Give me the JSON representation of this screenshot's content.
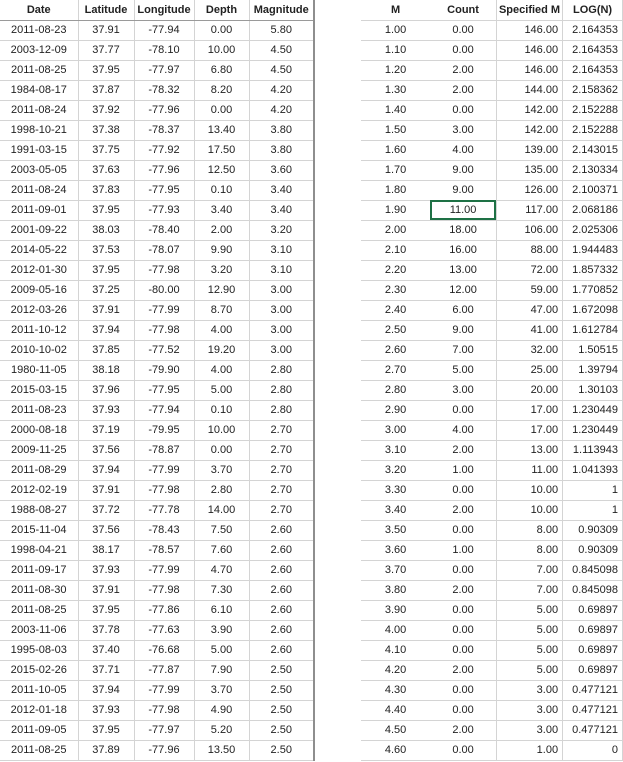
{
  "left_table": {
    "headers": [
      "Date",
      "Latitude",
      "Longitude",
      "Depth",
      "Magnitude"
    ],
    "rows": [
      [
        "2011-08-23",
        "37.91",
        "-77.94",
        "0.00",
        "5.80"
      ],
      [
        "2003-12-09",
        "37.77",
        "-78.10",
        "10.00",
        "4.50"
      ],
      [
        "2011-08-25",
        "37.95",
        "-77.97",
        "6.80",
        "4.50"
      ],
      [
        "1984-08-17",
        "37.87",
        "-78.32",
        "8.20",
        "4.20"
      ],
      [
        "2011-08-24",
        "37.92",
        "-77.96",
        "0.00",
        "4.20"
      ],
      [
        "1998-10-21",
        "37.38",
        "-78.37",
        "13.40",
        "3.80"
      ],
      [
        "1991-03-15",
        "37.75",
        "-77.92",
        "17.50",
        "3.80"
      ],
      [
        "2003-05-05",
        "37.63",
        "-77.96",
        "12.50",
        "3.60"
      ],
      [
        "2011-08-24",
        "37.83",
        "-77.95",
        "0.10",
        "3.40"
      ],
      [
        "2011-09-01",
        "37.95",
        "-77.93",
        "3.40",
        "3.40"
      ],
      [
        "2001-09-22",
        "38.03",
        "-78.40",
        "2.00",
        "3.20"
      ],
      [
        "2014-05-22",
        "37.53",
        "-78.07",
        "9.90",
        "3.10"
      ],
      [
        "2012-01-30",
        "37.95",
        "-77.98",
        "3.20",
        "3.10"
      ],
      [
        "2009-05-16",
        "37.25",
        "-80.00",
        "12.90",
        "3.00"
      ],
      [
        "2012-03-26",
        "37.91",
        "-77.99",
        "8.70",
        "3.00"
      ],
      [
        "2011-10-12",
        "37.94",
        "-77.98",
        "4.00",
        "3.00"
      ],
      [
        "2010-10-02",
        "37.85",
        "-77.52",
        "19.20",
        "3.00"
      ],
      [
        "1980-11-05",
        "38.18",
        "-79.90",
        "4.00",
        "2.80"
      ],
      [
        "2015-03-15",
        "37.96",
        "-77.95",
        "5.00",
        "2.80"
      ],
      [
        "2011-08-23",
        "37.93",
        "-77.94",
        "0.10",
        "2.80"
      ],
      [
        "2000-08-18",
        "37.19",
        "-79.95",
        "10.00",
        "2.70"
      ],
      [
        "2009-11-25",
        "37.56",
        "-78.87",
        "0.00",
        "2.70"
      ],
      [
        "2011-08-29",
        "37.94",
        "-77.99",
        "3.70",
        "2.70"
      ],
      [
        "2012-02-19",
        "37.91",
        "-77.98",
        "2.80",
        "2.70"
      ],
      [
        "1988-08-27",
        "37.72",
        "-77.78",
        "14.00",
        "2.70"
      ],
      [
        "2015-11-04",
        "37.56",
        "-78.43",
        "7.50",
        "2.60"
      ],
      [
        "1998-04-21",
        "38.17",
        "-78.57",
        "7.60",
        "2.60"
      ],
      [
        "2011-09-17",
        "37.93",
        "-77.99",
        "4.70",
        "2.60"
      ],
      [
        "2011-08-30",
        "37.91",
        "-77.98",
        "7.30",
        "2.60"
      ],
      [
        "2011-08-25",
        "37.95",
        "-77.86",
        "6.10",
        "2.60"
      ],
      [
        "2003-11-06",
        "37.78",
        "-77.63",
        "3.90",
        "2.60"
      ],
      [
        "1995-08-03",
        "37.40",
        "-76.68",
        "5.00",
        "2.60"
      ],
      [
        "2015-02-26",
        "37.71",
        "-77.87",
        "7.90",
        "2.50"
      ],
      [
        "2011-10-05",
        "37.94",
        "-77.99",
        "3.70",
        "2.50"
      ],
      [
        "2012-01-18",
        "37.93",
        "-77.98",
        "4.90",
        "2.50"
      ],
      [
        "2011-09-05",
        "37.95",
        "-77.97",
        "5.20",
        "2.50"
      ],
      [
        "2011-08-25",
        "37.89",
        "-77.96",
        "13.50",
        "2.50"
      ]
    ]
  },
  "right_table": {
    "headers": [
      "M",
      "Count",
      "Specified M",
      "LOG(N)"
    ],
    "rows": [
      [
        "1.00",
        "0.00",
        "146.00",
        "2.164353"
      ],
      [
        "1.10",
        "0.00",
        "146.00",
        "2.164353"
      ],
      [
        "1.20",
        "2.00",
        "146.00",
        "2.164353"
      ],
      [
        "1.30",
        "2.00",
        "144.00",
        "2.158362"
      ],
      [
        "1.40",
        "0.00",
        "142.00",
        "2.152288"
      ],
      [
        "1.50",
        "3.00",
        "142.00",
        "2.152288"
      ],
      [
        "1.60",
        "4.00",
        "139.00",
        "2.143015"
      ],
      [
        "1.70",
        "9.00",
        "135.00",
        "2.130334"
      ],
      [
        "1.80",
        "9.00",
        "126.00",
        "2.100371"
      ],
      [
        "1.90",
        "11.00",
        "117.00",
        "2.068186"
      ],
      [
        "2.00",
        "18.00",
        "106.00",
        "2.025306"
      ],
      [
        "2.10",
        "16.00",
        "88.00",
        "1.944483"
      ],
      [
        "2.20",
        "13.00",
        "72.00",
        "1.857332"
      ],
      [
        "2.30",
        "12.00",
        "59.00",
        "1.770852"
      ],
      [
        "2.40",
        "6.00",
        "47.00",
        "1.672098"
      ],
      [
        "2.50",
        "9.00",
        "41.00",
        "1.612784"
      ],
      [
        "2.60",
        "7.00",
        "32.00",
        "1.50515"
      ],
      [
        "2.70",
        "5.00",
        "25.00",
        "1.39794"
      ],
      [
        "2.80",
        "3.00",
        "20.00",
        "1.30103"
      ],
      [
        "2.90",
        "0.00",
        "17.00",
        "1.230449"
      ],
      [
        "3.00",
        "4.00",
        "17.00",
        "1.230449"
      ],
      [
        "3.10",
        "2.00",
        "13.00",
        "1.113943"
      ],
      [
        "3.20",
        "1.00",
        "11.00",
        "1.041393"
      ],
      [
        "3.30",
        "0.00",
        "10.00",
        "1"
      ],
      [
        "3.40",
        "2.00",
        "10.00",
        "1"
      ],
      [
        "3.50",
        "0.00",
        "8.00",
        "0.90309"
      ],
      [
        "3.60",
        "1.00",
        "8.00",
        "0.90309"
      ],
      [
        "3.70",
        "0.00",
        "7.00",
        "0.845098"
      ],
      [
        "3.80",
        "2.00",
        "7.00",
        "0.845098"
      ],
      [
        "3.90",
        "0.00",
        "5.00",
        "0.69897"
      ],
      [
        "4.00",
        "0.00",
        "5.00",
        "0.69897"
      ],
      [
        "4.10",
        "0.00",
        "5.00",
        "0.69897"
      ],
      [
        "4.20",
        "2.00",
        "5.00",
        "0.69897"
      ],
      [
        "4.30",
        "0.00",
        "3.00",
        "0.477121"
      ],
      [
        "4.40",
        "0.00",
        "3.00",
        "0.477121"
      ],
      [
        "4.50",
        "2.00",
        "3.00",
        "0.477121"
      ],
      [
        "4.60",
        "0.00",
        "1.00",
        "0"
      ]
    ],
    "selected_cell": {
      "row": 9,
      "col": 1
    },
    "selection_color": "#1e7145"
  }
}
